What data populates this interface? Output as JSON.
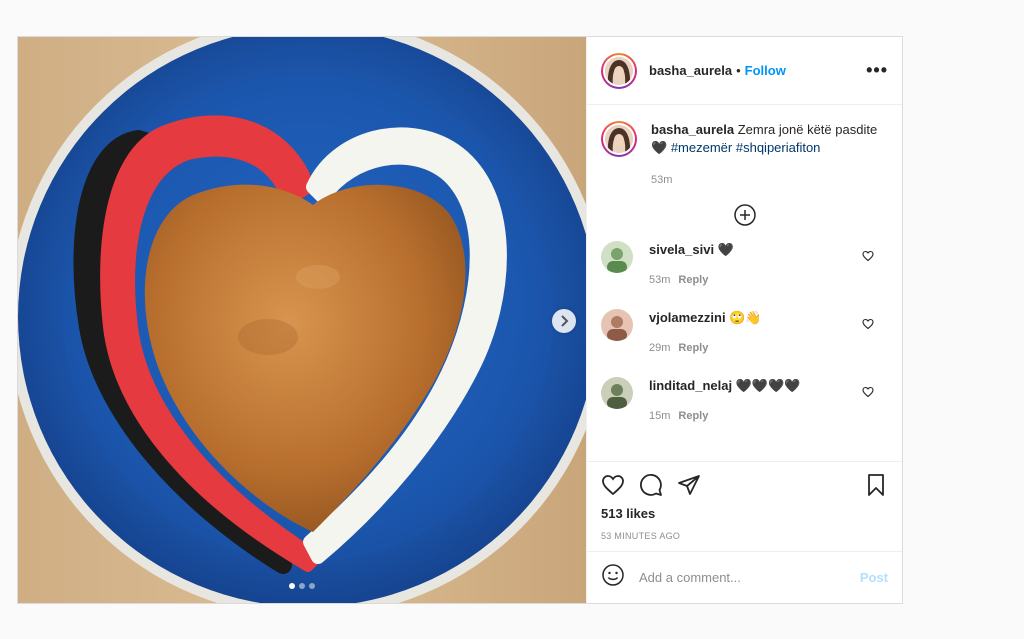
{
  "author": {
    "username": "basha_aurela",
    "separator": "•",
    "follow_label": "Follow",
    "more_label": "•••"
  },
  "caption": {
    "username": "basha_aurela",
    "text": " Zemra jonë këtë pasdite ",
    "emoji": "🖤",
    "tags": [
      "#mezemër",
      "#shqiperiafiton"
    ],
    "time": "53m"
  },
  "comments": [
    {
      "username": "sivela_sivi",
      "text": " 🖤",
      "time": "53m",
      "reply": "Reply",
      "avatar_color": "#7aa46b"
    },
    {
      "username": "vjolamezzini",
      "text": " 🙄👋",
      "time": "29m",
      "reply": "Reply",
      "avatar_color": "#b07b63"
    },
    {
      "username": "linditad_nelaj",
      "text": " 🖤🖤🖤🖤",
      "time": "15m",
      "reply": "Reply",
      "avatar_color": "#6e7f5c"
    }
  ],
  "actions": {
    "likes": "513 likes",
    "posted": "53 MINUTES AGO"
  },
  "add_comment": {
    "placeholder": "Add a comment...",
    "post_label": "Post"
  },
  "carousel": {
    "count": 3,
    "active": 0
  },
  "colors": {
    "accent": "#0095f6",
    "plate": "#1f5fb5",
    "cake": "#c07a36",
    "red_cream": "#e53a3f",
    "black_cream": "#1b1b1b",
    "white_cream": "#f5f5f0"
  }
}
